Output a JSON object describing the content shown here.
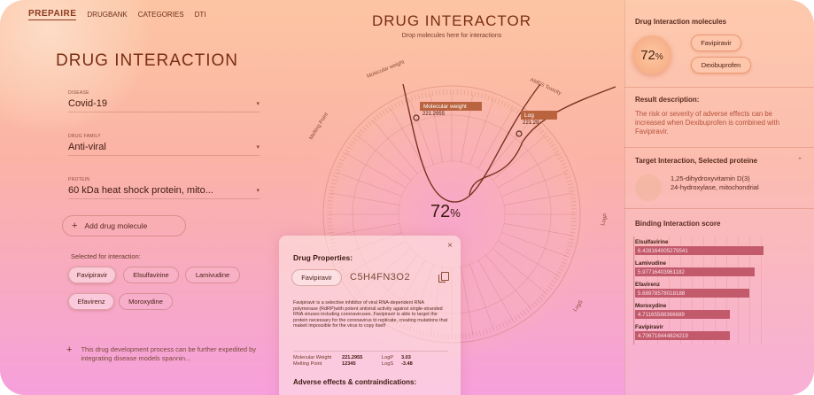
{
  "nav": {
    "logo": "PREPAIRE",
    "links": [
      "DRUGBANK",
      "CATEGORIES",
      "DTI"
    ]
  },
  "left": {
    "title": "DRUG INTERACTION",
    "fields": [
      {
        "label": "DISEASE",
        "value": "Covid-19"
      },
      {
        "label": "DRUG FAMILY",
        "value": "Anti-viral"
      },
      {
        "label": "PROTEIN",
        "value": "60 kDa heat shock protein, mito..."
      }
    ],
    "add_button": "Add drug molecule",
    "selected_label": "Selected for interaction:",
    "chips": [
      "Favipiravir",
      "Elsulfavirine",
      "Lamivudine",
      "Efavirenz",
      "Moroxydine"
    ],
    "footnote": "This drug development process can be further expedited by integrating disease models spannin..."
  },
  "center": {
    "title": "DRUG INTERACTOR",
    "subtitle": "Drop molecules here for interactions",
    "percent": "72",
    "percent_unit": "%",
    "wheel_labels": [
      "Molecular weight",
      "AMES Toxicity",
      "Melting Point",
      "LogP",
      "LogS"
    ],
    "annotations": [
      {
        "label": "Molecular weight",
        "value": "221.2955"
      },
      {
        "label": "Log",
        "value": "221.29"
      }
    ]
  },
  "drug_panel": {
    "close": "×",
    "title": "Drug Properties:",
    "chip": "Favipiravir",
    "formula": "C5H4FN3O2",
    "description": "Favipiravir is a selective inhibitor of viral RNA-dependent RNA polymerase (RdRP)with potent antiviral activity against single-stranded RNA viruses including coronaviruses. Favipiravir is able to target the protein necessary for the coronavirus to replicate, creating mutations that makeit impossible for the virus to copy itself",
    "props": [
      {
        "k": "Molecular Weight",
        "v": "221.2955",
        "k2": "LogP",
        "v2": "3.03"
      },
      {
        "k": "Melting Point",
        "v": "12345",
        "k2": "LogS",
        "v2": "-3.48"
      }
    ],
    "adverse_title": "Adverse effects & contraindications:"
  },
  "right": {
    "molecules_title": "Drug Interaction molecules",
    "percent": "72",
    "percent_unit": "%",
    "molecules": [
      "Favipiravir",
      "Dexibuprofen"
    ],
    "result_title": "Result description:",
    "result_text": "The risk or severity of adverse effects can be increased when Dexibuprofen is combined with Favipiravir.",
    "target_title": "Target Interaction, Selected proteine",
    "target_text_1": "1,25-dihydroxyvitamin D(3)",
    "target_text_2": "24-hydroxylase, mitochondrial",
    "binding_title": "Binding Interaction score",
    "bars": [
      {
        "name": "Elsulfavirine",
        "value": "6.428164005279541"
      },
      {
        "name": "Lamivudine",
        "value": "5.97716403961182"
      },
      {
        "name": "Efavirenz",
        "value": "5.68978578018188"
      },
      {
        "name": "Moroxydine",
        "value": "4.71165588366689"
      },
      {
        "name": "Favipiravir",
        "value": "4.706718444824219"
      }
    ]
  },
  "colors": {
    "accent": "#b9643f",
    "bar": "#c25a6c",
    "result_text": "#b5523a"
  }
}
